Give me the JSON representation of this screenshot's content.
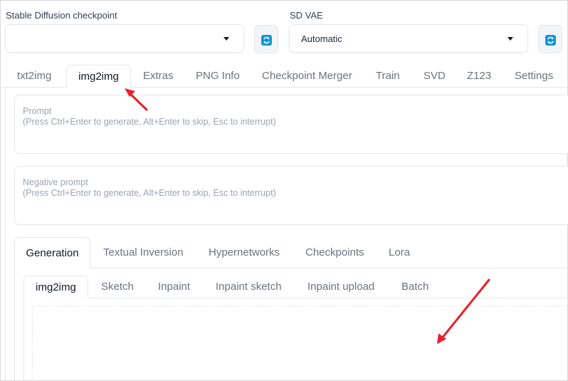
{
  "checkpoint": {
    "label": "Stable Diffusion checkpoint",
    "value": ""
  },
  "vae": {
    "label": "SD VAE",
    "value": "Automatic"
  },
  "main_tabs": [
    "txt2img",
    "img2img",
    "Extras",
    "PNG Info",
    "Checkpoint Merger",
    "Train",
    "SVD",
    "Z123",
    "Settings"
  ],
  "active_main_tab": "img2img",
  "prompt": {
    "label": "Prompt",
    "hint": "(Press Ctrl+Enter to generate, Alt+Enter to skip, Esc to interrupt)"
  },
  "negative_prompt": {
    "label": "Negative prompt",
    "hint": "(Press Ctrl+Enter to generate, Alt+Enter to skip, Esc to interrupt)"
  },
  "generation_tabs": [
    "Generation",
    "Textual Inversion",
    "Hypernetworks",
    "Checkpoints",
    "Lora"
  ],
  "active_generation_tab": "Generation",
  "img2img_tabs": [
    "img2img",
    "Sketch",
    "Inpaint",
    "Inpaint sketch",
    "Inpaint upload",
    "Batch"
  ],
  "active_img2img_tab": "img2img",
  "colors": {
    "annotation_arrow": "#e8202a",
    "refresh_icon": "#1296db"
  },
  "icons": {
    "refresh": "refresh-icon",
    "dropdown": "chevron-down-icon"
  }
}
